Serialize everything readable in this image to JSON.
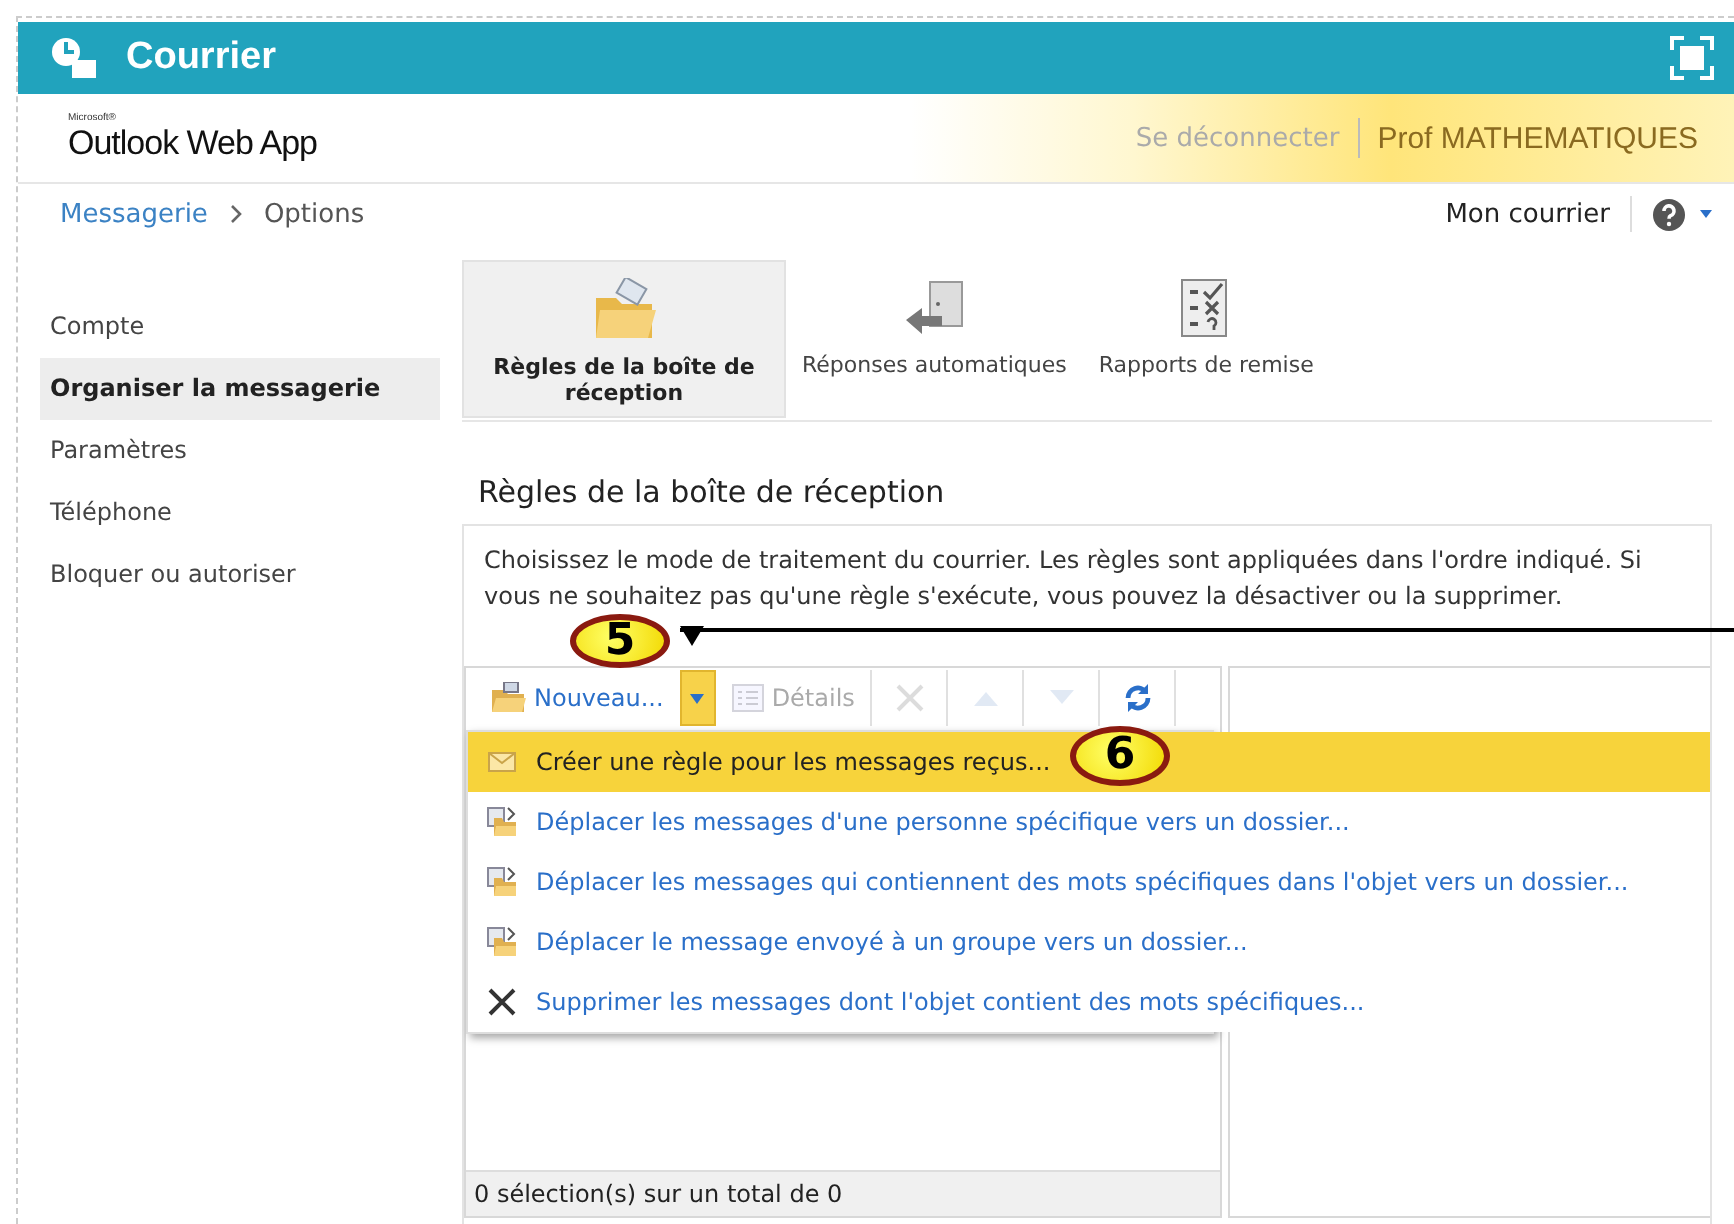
{
  "header": {
    "title": "Courrier"
  },
  "brand": {
    "small": "Microsoft®",
    "name": "Outlook Web App"
  },
  "user_bar": {
    "sign_out": "Se déconnecter",
    "user": "Prof MATHEMATIQUES"
  },
  "breadcrumb": [
    "Messagerie",
    "Options"
  ],
  "top_right": {
    "my_mail": "Mon courrier"
  },
  "sidebar": {
    "items": [
      {
        "label": "Compte",
        "selected": false
      },
      {
        "label": "Organiser la messagerie",
        "selected": true
      },
      {
        "label": "Paramètres",
        "selected": false
      },
      {
        "label": "Téléphone",
        "selected": false
      },
      {
        "label": "Bloquer ou autoriser",
        "selected": false
      }
    ]
  },
  "tabs": [
    {
      "label": "Règles de la boîte de réception",
      "kind": "folder",
      "selected": true
    },
    {
      "label": "Réponses automatiques",
      "kind": "door",
      "selected": false
    },
    {
      "label": "Rapports de remise",
      "kind": "checklist",
      "selected": false
    }
  ],
  "section": {
    "title": "Règles de la boîte de réception",
    "description": "Choisissez le mode de traitement du courrier. Les règles sont appliquées dans l'ordre indiqué. Si vous ne souhaitez pas qu'une règle s'exécute, vous pouvez la désactiver ou la supprimer."
  },
  "toolbar": [
    {
      "kind": "new",
      "label": "Nouveau...",
      "disabled": false
    },
    {
      "kind": "dropdown",
      "selected": true
    },
    {
      "kind": "details",
      "label": "Détails",
      "disabled": true
    },
    {
      "kind": "delete",
      "disabled": true
    },
    {
      "kind": "up",
      "disabled": true
    },
    {
      "kind": "down",
      "disabled": true
    },
    {
      "kind": "refresh",
      "disabled": false
    }
  ],
  "menu": [
    {
      "kind": "envelope",
      "label": "Créer une règle pour les messages reçus...",
      "selected": true
    },
    {
      "kind": "move",
      "label": "Déplacer les messages d'une personne spécifique vers un dossier...",
      "selected": false
    },
    {
      "kind": "move",
      "label": "Déplacer les messages qui contiennent des mots spécifiques dans l'objet vers un dossier...",
      "selected": false
    },
    {
      "kind": "move",
      "label": "Déplacer le message envoyé à un groupe vers un dossier...",
      "selected": false
    },
    {
      "kind": "delete",
      "label": "Supprimer les messages dont l'objet contient des mots spécifiques...",
      "selected": false
    }
  ],
  "status_bar": "0 sélection(s) sur un total de 0",
  "callouts": [
    "5",
    "6"
  ]
}
